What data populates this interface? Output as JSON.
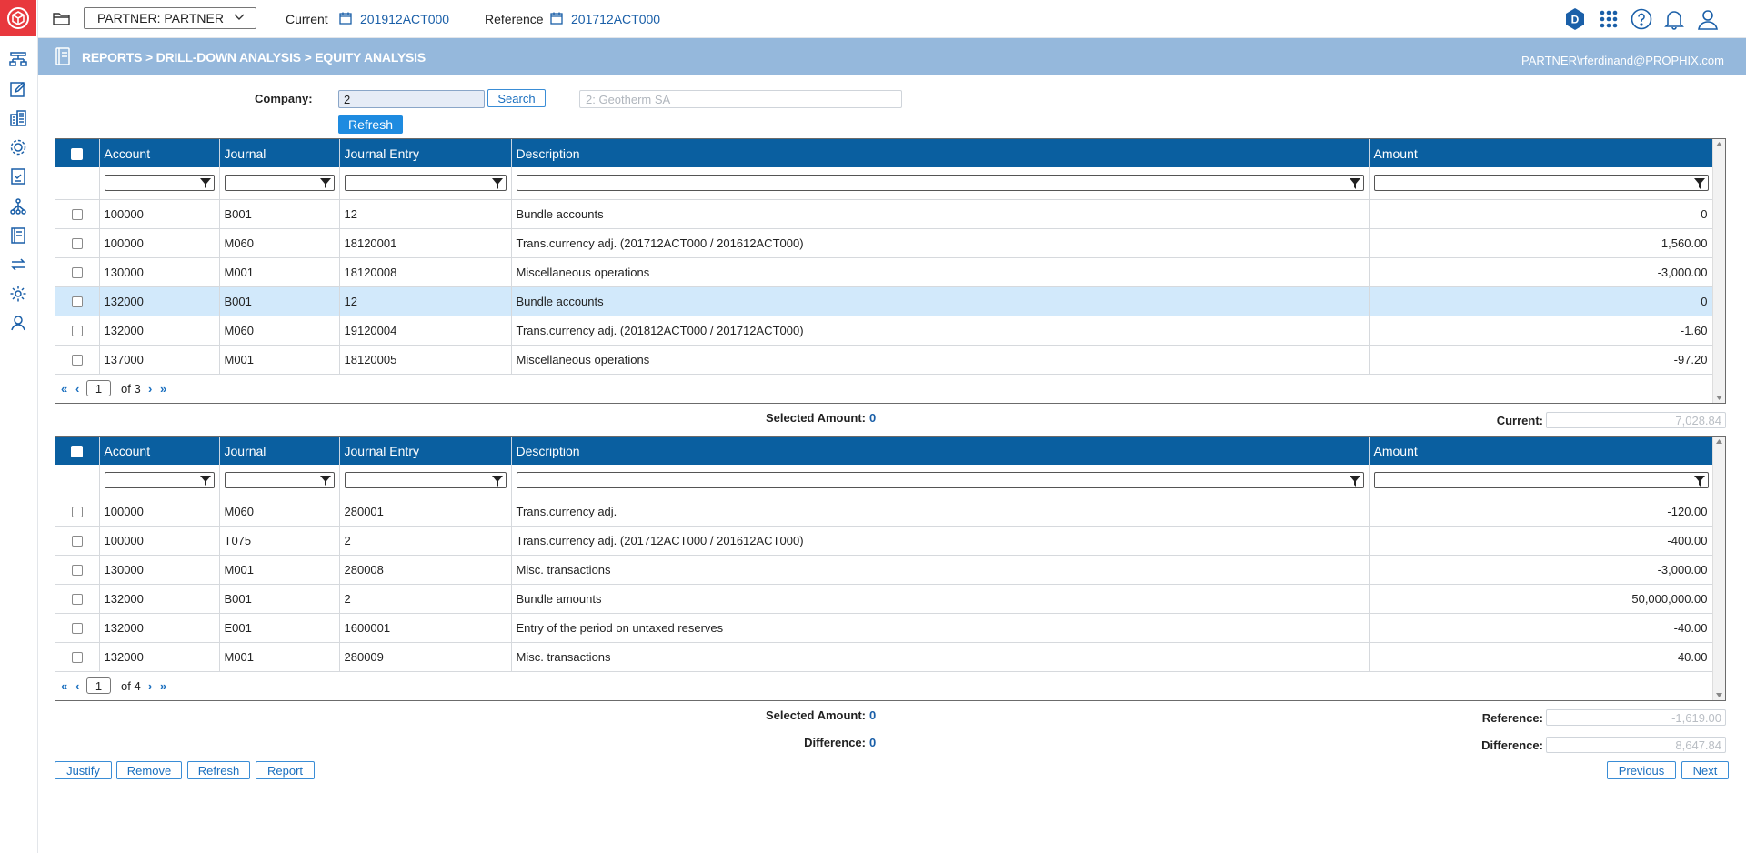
{
  "topbar": {
    "partner_select": "PARTNER: PARTNER",
    "current_label": "Current",
    "current_value": "201912ACT000",
    "reference_label": "Reference",
    "reference_value": "201712ACT000"
  },
  "band": {
    "title": "REPORTS > DRILL-DOWN ANALYSIS > EQUITY ANALYSIS",
    "user": "PARTNER\\rferdinand@PROPHIX.com"
  },
  "company": {
    "label": "Company:",
    "value": "2",
    "search_label": "Search",
    "name_placeholder": "2: Geotherm SA",
    "refresh_label": "Refresh"
  },
  "columns": [
    "Account",
    "Journal",
    "Journal Entry",
    "Description",
    "Amount"
  ],
  "grid1": {
    "rows": [
      {
        "account": "100000",
        "journal": "B001",
        "entry": "12",
        "description": "Bundle accounts",
        "amount": "0"
      },
      {
        "account": "100000",
        "journal": "M060",
        "entry": "18120001",
        "description": "Trans.currency adj. (201712ACT000 / 201612ACT000)",
        "amount": "1,560.00"
      },
      {
        "account": "130000",
        "journal": "M001",
        "entry": "18120008",
        "description": "Miscellaneous operations",
        "amount": "-3,000.00"
      },
      {
        "account": "132000",
        "journal": "B001",
        "entry": "12",
        "description": "Bundle accounts",
        "amount": "0"
      },
      {
        "account": "132000",
        "journal": "M060",
        "entry": "19120004",
        "description": "Trans.currency adj. (201812ACT000 / 201712ACT000)",
        "amount": "-1.60"
      },
      {
        "account": "137000",
        "journal": "M001",
        "entry": "18120005",
        "description": "Miscellaneous operations",
        "amount": "-97.20"
      }
    ],
    "page": "1",
    "of_pages": "of  3",
    "selected_label": "Selected Amount:",
    "selected_value": "0",
    "current_label": "Current:",
    "current_value": "7,028.84"
  },
  "grid2": {
    "rows": [
      {
        "account": "100000",
        "journal": "M060",
        "entry": "280001",
        "description": "Trans.currency adj.",
        "amount": "-120.00"
      },
      {
        "account": "100000",
        "journal": "T075",
        "entry": "2",
        "description": "Trans.currency adj. (201712ACT000 / 201612ACT000)",
        "amount": "-400.00"
      },
      {
        "account": "130000",
        "journal": "M001",
        "entry": "280008",
        "description": "Misc. transactions",
        "amount": "-3,000.00"
      },
      {
        "account": "132000",
        "journal": "B001",
        "entry": "2",
        "description": "Bundle amounts",
        "amount": "50,000,000.00"
      },
      {
        "account": "132000",
        "journal": "E001",
        "entry": "1600001",
        "description": "Entry of the period on untaxed reserves",
        "amount": "-40.00"
      },
      {
        "account": "132000",
        "journal": "M001",
        "entry": "280009",
        "description": "Misc. transactions",
        "amount": "40.00"
      }
    ],
    "page": "1",
    "of_pages": "of  4",
    "selected_label": "Selected Amount:",
    "selected_value": "0",
    "difference_label": "Difference:",
    "difference_value": "0",
    "reference_label": "Reference:",
    "reference_value": "-1,619.00",
    "difference_field_label": "Difference:",
    "difference_field_value": "8,647.84"
  },
  "actions": {
    "justify": "Justify",
    "remove": "Remove",
    "refresh": "Refresh",
    "report": "Report",
    "previous": "Previous",
    "next": "Next"
  },
  "colors": {
    "header_bg": "#0a5fa0",
    "band_bg": "#95b8dc",
    "logo_bg": "#e8383d",
    "link": "#1a5fa8",
    "selected_row": "#d2e9fb"
  }
}
